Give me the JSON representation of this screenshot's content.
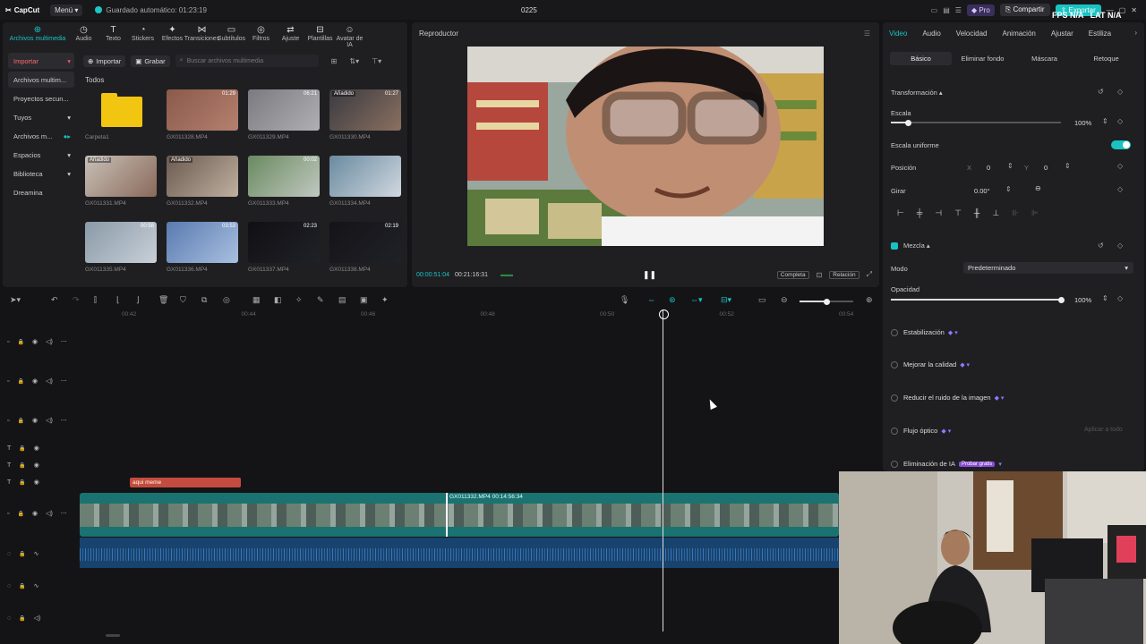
{
  "app": {
    "logo": "CapCut",
    "menu_label": "Menú",
    "autosave_text": "Guardado automático: 01:23:19",
    "project_title": "0225",
    "pro_label": "Pro",
    "share_label": "Compartir",
    "export_label": "Exportar",
    "overlay_text": "FPS N/A   LAT N/A"
  },
  "media_tools": [
    {
      "label": "Archivos multimedia",
      "icon": "media-icon"
    },
    {
      "label": "Audio",
      "icon": "audio-icon"
    },
    {
      "label": "Texto",
      "icon": "text-icon"
    },
    {
      "label": "Stickers",
      "icon": "sticker-icon"
    },
    {
      "label": "Efectos",
      "icon": "effects-icon"
    },
    {
      "label": "Transiciones",
      "icon": "transitions-icon"
    },
    {
      "label": "Subtítulos",
      "icon": "subtitles-icon"
    },
    {
      "label": "Filtros",
      "icon": "filters-icon"
    },
    {
      "label": "Ajuste",
      "icon": "adjust-icon"
    },
    {
      "label": "Plantillas",
      "icon": "templates-icon"
    },
    {
      "label": "Avatar de IA",
      "icon": "avatar-icon"
    }
  ],
  "left_nav": [
    {
      "label": "Importar"
    },
    {
      "label": "Archivos multim..."
    },
    {
      "label": "Proyectos secun..."
    },
    {
      "label": "Tuyos"
    },
    {
      "label": "Archivos m..."
    },
    {
      "label": "Espacios"
    },
    {
      "label": "Biblioteca"
    },
    {
      "label": "Dreamina"
    }
  ],
  "media_toolbar": {
    "import_label": "Importar",
    "record_label": "Grabar",
    "search_placeholder": "Buscar archivos multimedia",
    "all_label": "Todos"
  },
  "media_items": [
    {
      "name": "Carpeta1",
      "duration": "",
      "tag": ""
    },
    {
      "name": "GX011328.MP4",
      "duration": "01:29",
      "tag": ""
    },
    {
      "name": "GX011329.MP4",
      "duration": "06:21",
      "tag": ""
    },
    {
      "name": "GX011330.MP4",
      "duration": "01:27",
      "tag": "Añadido"
    },
    {
      "name": "GX011331.MP4",
      "duration": "",
      "tag": "Añadido"
    },
    {
      "name": "GX011332.MP4",
      "duration": "",
      "tag": "Añadido"
    },
    {
      "name": "GX011333.MP4",
      "duration": "00:02",
      "tag": ""
    },
    {
      "name": "GX011334.MP4",
      "duration": "",
      "tag": ""
    },
    {
      "name": "GX011335.MP4",
      "duration": "00:58",
      "tag": ""
    },
    {
      "name": "GX011336.MP4",
      "duration": "03:53",
      "tag": ""
    },
    {
      "name": "GX011337.MP4",
      "duration": "02:23",
      "tag": ""
    },
    {
      "name": "GX011338.MP4",
      "duration": "02:19",
      "tag": ""
    }
  ],
  "player": {
    "title": "Reproductor",
    "current_time": "00:00:51:04",
    "total_time": "00:21:16:31",
    "full_label": "Completa",
    "ratio_label": "Relación"
  },
  "props": {
    "tabs": [
      "Video",
      "Audio",
      "Velocidad",
      "Animación",
      "Ajustar",
      "Estiliza"
    ],
    "subtabs": [
      "Básico",
      "Eliminar fondo",
      "Máscara",
      "Retoque"
    ],
    "transform_label": "Transformación",
    "scale_label": "Escala",
    "scale_value": "100%",
    "scale_level": 0.1,
    "uniform_label": "Escala uniforme",
    "position_label": "Posición",
    "pos_x_label": "X",
    "pos_x": "0",
    "pos_y_label": "Y",
    "pos_y": "0",
    "rotate_label": "Girar",
    "rotate_value": "0.00°",
    "blend_label": "Mezcla",
    "mode_label": "Modo",
    "mode_value": "Predeterminado",
    "opacity_label": "Opacidad",
    "opacity_value": "100%",
    "opacity_level": 1.0,
    "stabilization": "Estabilización",
    "enhance": "Mejorar la calidad",
    "denoise": "Reducir el ruido de la imagen",
    "optical_flow": "Flujo óptico",
    "apply_all": "Aplicar a todo",
    "ai_remove": "Eliminación de IA",
    "ai_badge": "Probar gratis"
  },
  "timeline": {
    "ruler": [
      "00:42",
      "00:44",
      "00:46",
      "00:48",
      "00:50",
      "00:52",
      "00:54"
    ],
    "text_clip": "aqui meme",
    "video_clip_label": "GX011332.MP4   00:14:56:34"
  }
}
